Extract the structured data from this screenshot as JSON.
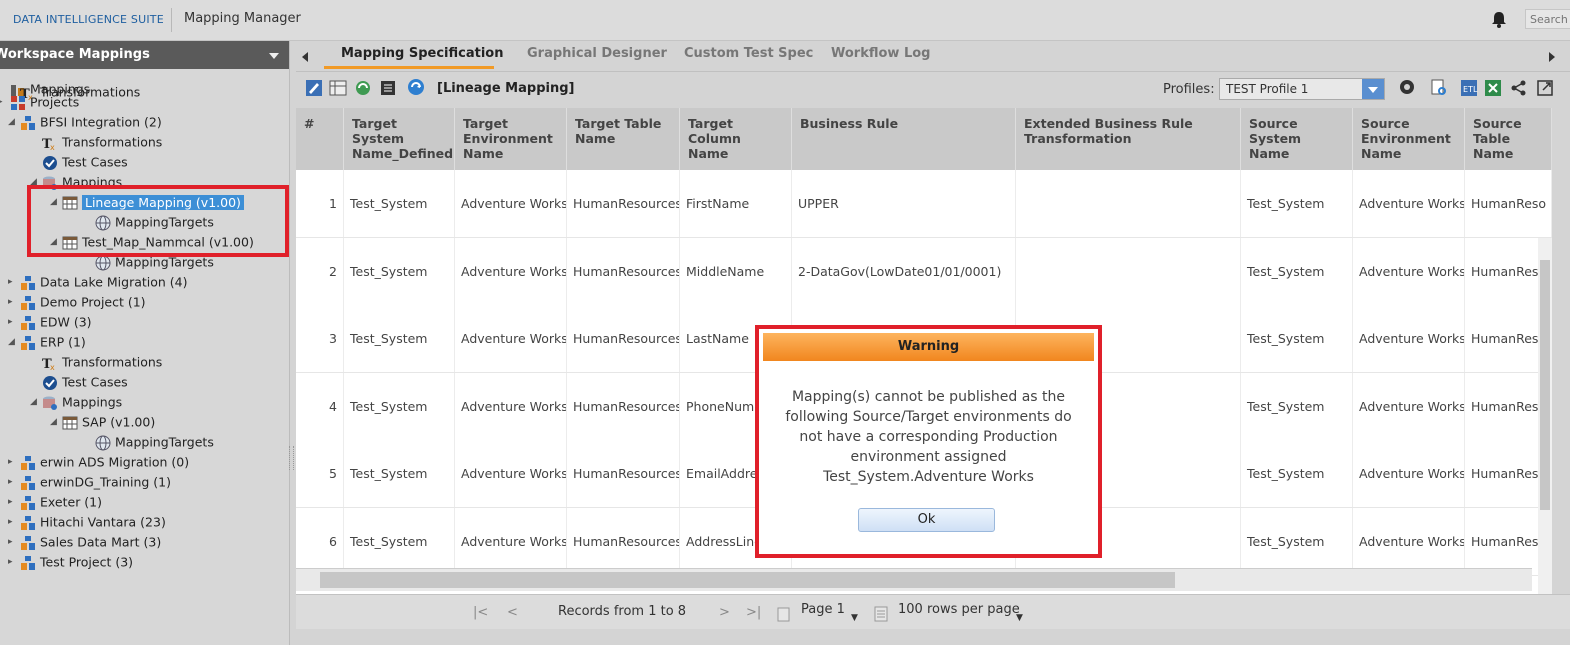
{
  "header": {
    "suite_name": "DATA INTELLIGENCE SUITE",
    "app_title": "Mapping Manager",
    "search_placeholder": "Search"
  },
  "left_panel": {
    "title": "Workspace Mappings",
    "tree": [
      {
        "label": "Mappings",
        "icon": "mappings-root-icon"
      },
      {
        "label": "Transformations",
        "icon": "transformations-icon"
      },
      {
        "label": "Projects",
        "icon": "projects-grid-icon"
      },
      {
        "label": "BFSI Integration (2)",
        "icon": "project-icon"
      },
      {
        "label": "Transformations",
        "icon": "transformations-icon"
      },
      {
        "label": "Test Cases",
        "icon": "test-cases-icon"
      },
      {
        "label": "Mappings",
        "icon": "mappings-db-icon"
      },
      {
        "label": "Lineage Mapping (v1.00)",
        "icon": "table-icon",
        "selected": true
      },
      {
        "label": "MappingTargets",
        "icon": "globe-icon"
      },
      {
        "label": "Test_Map_Nammcal (v1.00)",
        "icon": "table-icon"
      },
      {
        "label": "MappingTargets",
        "icon": "globe-icon"
      },
      {
        "label": "Data Lake Migration (4)",
        "icon": "project-icon"
      },
      {
        "label": "Demo Project (1)",
        "icon": "project-icon"
      },
      {
        "label": "EDW (3)",
        "icon": "project-icon"
      },
      {
        "label": "ERP (1)",
        "icon": "project-icon"
      },
      {
        "label": "Transformations",
        "icon": "transformations-icon"
      },
      {
        "label": "Test Cases",
        "icon": "test-cases-icon"
      },
      {
        "label": "Mappings",
        "icon": "mappings-db-icon"
      },
      {
        "label": "SAP (v1.00)",
        "icon": "table-icon"
      },
      {
        "label": "MappingTargets",
        "icon": "globe-icon"
      },
      {
        "label": "erwin ADS Migration (0)",
        "icon": "project-icon"
      },
      {
        "label": "erwinDG_Training (1)",
        "icon": "project-icon"
      },
      {
        "label": "Exeter (1)",
        "icon": "project-icon"
      },
      {
        "label": "Hitachi Vantara (23)",
        "icon": "project-icon"
      },
      {
        "label": "Sales Data Mart (3)",
        "icon": "project-icon"
      },
      {
        "label": "Test Project (3)",
        "icon": "project-icon"
      }
    ]
  },
  "tabs": [
    {
      "label": "Mapping Specification",
      "active": true
    },
    {
      "label": "Graphical Designer"
    },
    {
      "label": "Custom Test Spec"
    },
    {
      "label": "Workflow Log"
    }
  ],
  "toolbar": {
    "mapping_title": "[Lineage Mapping]",
    "profiles_label": "Profiles:",
    "profile_value": "TEST Profile 1"
  },
  "grid": {
    "headers": [
      "#",
      "Target System Name_Defined",
      "Target Environment Name",
      "Target Table Name",
      "Target Column Name",
      "Business Rule",
      "Extended Business Rule Transformation",
      "Source System Name",
      "Source Environment Name",
      "Source Table Name"
    ],
    "rows": [
      [
        "1",
        "Test_System",
        "Adventure Works",
        "HumanResources.",
        "FirstName",
        "UPPER",
        "",
        "Test_System",
        "Adventure Works",
        "HumanReso"
      ],
      [
        "2",
        "Test_System",
        "Adventure Works",
        "HumanResources.",
        "MiddleName",
        "2-DataGov(LowDate01/01/0001)",
        "",
        "Test_System",
        "Adventure Works",
        "HumanReso"
      ],
      [
        "3",
        "Test_System",
        "Adventure Works",
        "HumanResources.",
        "LastName",
        "",
        "",
        "Test_System",
        "Adventure Works",
        "HumanReso"
      ],
      [
        "4",
        "Test_System",
        "Adventure Works",
        "HumanResources.",
        "PhoneNumb",
        "",
        "",
        "Test_System",
        "Adventure Works",
        "HumanReso"
      ],
      [
        "5",
        "Test_System",
        "Adventure Works",
        "HumanResources.",
        "EmailAddre",
        "",
        "",
        "Test_System",
        "Adventure Works",
        "HumanReso"
      ],
      [
        "6",
        "Test_System",
        "Adventure Works",
        "HumanResources.",
        "AddressLine",
        "",
        "",
        "Test_System",
        "Adventure Works",
        "HumanReso"
      ]
    ]
  },
  "pager": {
    "records_text": "Records from 1 to 8",
    "page_label": "Page 1",
    "rows_per_page": "100 rows per page"
  },
  "modal": {
    "title": "Warning",
    "message": "Mapping(s) cannot be published as the following Source/Target environments do not have a corresponding Production environment assigned Test_System.Adventure Works",
    "ok_label": "Ok"
  },
  "colors": {
    "accent_orange": "#f19a26",
    "highlight_red": "#e0202a",
    "selection_blue": "#3d8fd6"
  }
}
